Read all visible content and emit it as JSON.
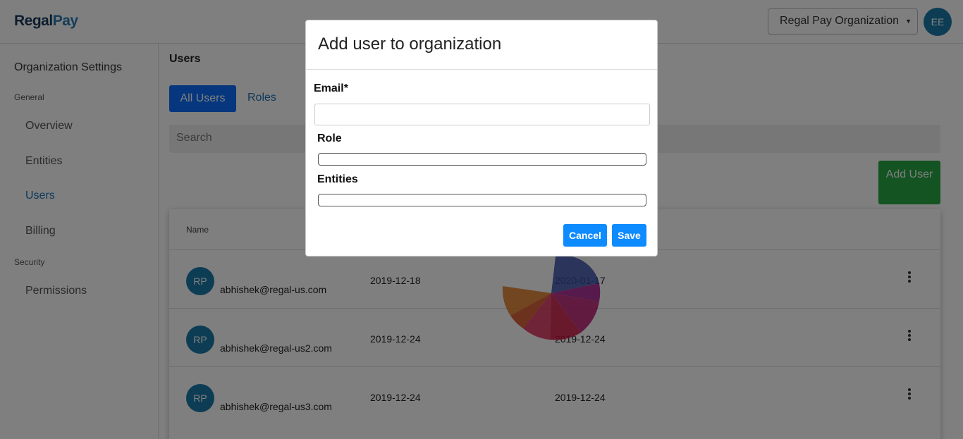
{
  "header": {
    "logo_regal": "Regal",
    "logo_pay": "Pay",
    "org_select_value": "Regal Pay Organization",
    "avatar_initials": "EE"
  },
  "sidebar": {
    "title": "Organization Settings",
    "sections": [
      {
        "label": "General",
        "items": [
          {
            "label": "Overview"
          },
          {
            "label": "Entities"
          },
          {
            "label": "Users",
            "active": true
          },
          {
            "label": "Billing"
          }
        ]
      },
      {
        "label": "Security",
        "items": [
          {
            "label": "Permissions"
          }
        ]
      }
    ]
  },
  "main": {
    "title": "Users",
    "tabs": [
      {
        "label": "All Users",
        "active": true
      },
      {
        "label": "Roles"
      }
    ],
    "search_placeholder": "Search",
    "add_user_label": "Add User",
    "table": {
      "headers": [
        "Name"
      ],
      "rows": [
        {
          "initials": "RP",
          "email": "abhishek@regal-us.com",
          "date1": "2019-12-18",
          "date2": "2020-01-17"
        },
        {
          "initials": "RP",
          "email": "abhishek@regal-us2.com",
          "date1": "2019-12-24",
          "date2": "2019-12-24"
        },
        {
          "initials": "RP",
          "email": "abhishek@regal-us3.com",
          "date1": "2019-12-24",
          "date2": "2019-12-24"
        }
      ]
    }
  },
  "modal": {
    "title": "Add user to organization",
    "email_label": "Email*",
    "role_label": "Role",
    "entities_label": "Entities",
    "cancel_label": "Cancel",
    "save_label": "Save"
  },
  "colors": {
    "primary": "#0d6efd",
    "success": "#28a745",
    "avatar": "#1b7aa8",
    "link": "#1e73b8"
  }
}
